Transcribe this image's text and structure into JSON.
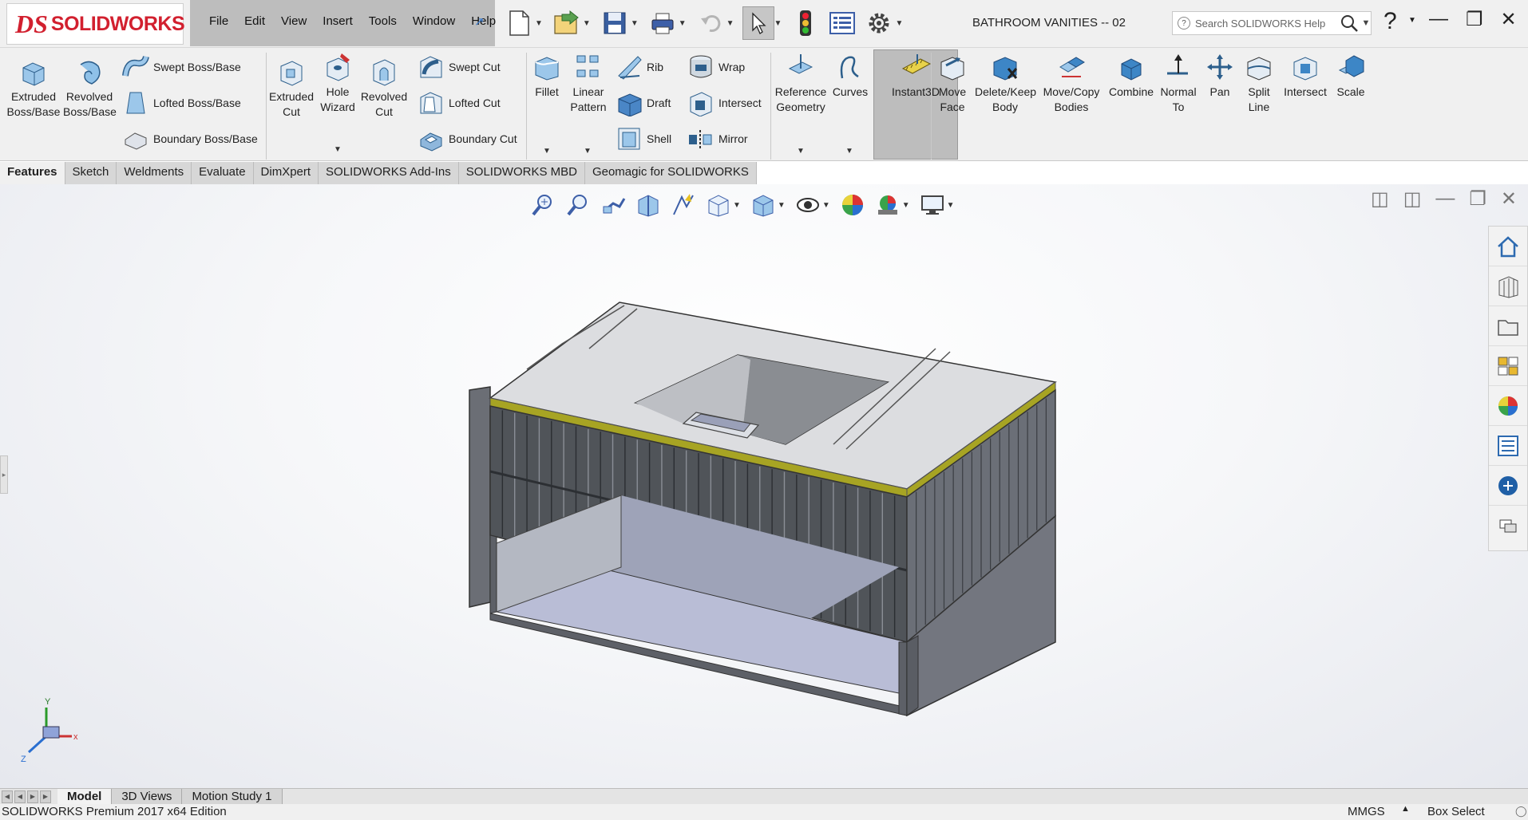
{
  "app": {
    "logo_prefix": "DS",
    "logo_text": "SOLIDWORKS"
  },
  "menu": [
    "File",
    "Edit",
    "View",
    "Insert",
    "Tools",
    "Window",
    "Help"
  ],
  "document_title": "BATHROOM VANITIES -- 02",
  "search": {
    "placeholder": "Search SOLIDWORKS Help"
  },
  "ribbon": {
    "extruded_boss": "Extruded Boss/Base",
    "revolved_boss": "Revolved Boss/Base",
    "swept_boss": "Swept Boss/Base",
    "lofted_boss": "Lofted Boss/Base",
    "boundary_boss": "Boundary Boss/Base",
    "extruded_cut": "Extruded Cut",
    "hole_wizard": "Hole Wizard",
    "revolved_cut": "Revolved Cut",
    "swept_cut": "Swept Cut",
    "lofted_cut": "Lofted Cut",
    "boundary_cut": "Boundary Cut",
    "fillet": "Fillet",
    "linear_pattern": "Linear Pattern",
    "rib": "Rib",
    "draft": "Draft",
    "shell": "Shell",
    "wrap": "Wrap",
    "intersect_small": "Intersect",
    "mirror": "Mirror",
    "reference_geometry": "Reference Geometry",
    "curves": "Curves",
    "instant3d": "Instant3D",
    "move_face": "Move Face",
    "delete_keep_body": "Delete/Keep Body",
    "move_copy_bodies": "Move/Copy Bodies",
    "combine": "Combine",
    "normal_to": "Normal To",
    "pan": "Pan",
    "split_line": "Split Line",
    "intersect": "Intersect",
    "scale": "Scale"
  },
  "tabs": [
    "Features",
    "Sketch",
    "Weldments",
    "Evaluate",
    "DimXpert",
    "SOLIDWORKS Add-Ins",
    "SOLIDWORKS MBD",
    "Geomagic for SOLIDWORKS"
  ],
  "active_tab": "Features",
  "triad": {
    "x": "x",
    "y": "Y",
    "z": "Z"
  },
  "bottom_tabs": [
    "Model",
    "3D Views",
    "Motion Study 1"
  ],
  "status": {
    "left": "SOLIDWORKS Premium 2017 x64 Edition",
    "units": "MMGS",
    "mode": "Box Select"
  },
  "colors": {
    "accent": "#d2202f",
    "model_gray": "#5b5f66",
    "model_top": "#d8d9dc",
    "trim": "#a7a423",
    "panel_blue": "#b9bdd6"
  }
}
